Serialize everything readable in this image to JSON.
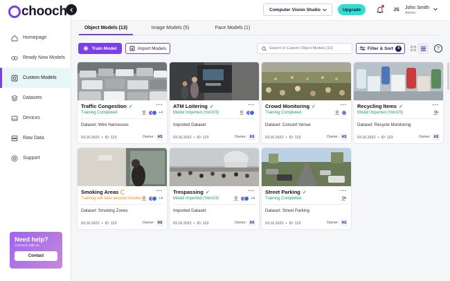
{
  "brand": {
    "name": "chooch"
  },
  "sidebar": {
    "items": [
      {
        "label": "Homepage",
        "icon": "home-icon"
      },
      {
        "label": "Ready Now Models",
        "icon": "eye-icon"
      },
      {
        "label": "Custom Models",
        "icon": "custom-models-icon",
        "active": true
      },
      {
        "label": "Datasets",
        "icon": "layers-icon"
      },
      {
        "label": "Devices",
        "icon": "device-icon"
      },
      {
        "label": "Raw Data",
        "icon": "database-icon"
      },
      {
        "label": "Support",
        "icon": "support-icon"
      }
    ],
    "help": {
      "title": "Need help?",
      "subtitle": "Connect with us",
      "button": "Contact"
    }
  },
  "topbar": {
    "studio": "Computer Vision Studio",
    "upgrade": "Upgrade",
    "user": {
      "initials": "JS",
      "name": "John Smith",
      "role": "Admin"
    }
  },
  "tabs": [
    {
      "label": "Object Models (13)",
      "active": true
    },
    {
      "label": "Image Models (5)"
    },
    {
      "label": "Face Models (1)"
    }
  ],
  "toolbar": {
    "train": "Train Model",
    "import": "Import Models",
    "search_placeholder": "Search in Custom Object Models (13)",
    "filter": "Filter & Sort",
    "filter_count": "4",
    "help": "?"
  },
  "cards": [
    {
      "title": "Traffic Congestion",
      "status": "Training Completed",
      "status_type": "done",
      "dataset": "Dataset: Wire Harnesses",
      "date": "03.16.2022",
      "id": "ID: 123",
      "owner_label": "Owner:",
      "owner": "AS",
      "people": true,
      "more": "+4"
    },
    {
      "title": "ATM Loitering",
      "status": "Model Imported (YoloV3)",
      "status_type": "import",
      "dataset": "Imported Dataset",
      "date": "03.16.2022",
      "id": "ID: 123",
      "owner_label": "Owner:",
      "owner": "AS",
      "people": true,
      "more": ""
    },
    {
      "title": "Crowd Monitoring",
      "status": "Training Completed",
      "status_type": "done",
      "dataset": "Dataset: Concert Venue",
      "date": "03.16.2022",
      "id": "ID: 123",
      "owner_label": "Owner:",
      "owner": "AS",
      "people": true,
      "more": ""
    },
    {
      "title": "Recycling Items",
      "status": "Model Imported (YoloV3)",
      "status_type": "import",
      "dataset": "Dataset: Recycle Monitoring",
      "date": "03.16.2022",
      "id": "ID: 123",
      "owner_label": "Owner:",
      "owner": "AS",
      "people": false,
      "more": ""
    },
    {
      "title": "Smoking Areas",
      "status": "Training will take several minutes",
      "status_type": "warn",
      "dataset": "Dataset: Smoking Zones",
      "date": "03.16.2022",
      "id": "ID: 123",
      "owner_label": "Owner:",
      "owner": "AS",
      "people": true,
      "more": "+4"
    },
    {
      "title": "Trespassing",
      "status": "Model Imported (YoloV3)",
      "status_type": "import",
      "dataset": "Imported Dataset",
      "date": "03.16.2022",
      "id": "ID: 123",
      "owner_label": "Owner:",
      "owner": "AS",
      "people": true,
      "more": "+4"
    },
    {
      "title": "Street Parking",
      "status": "Training Completed",
      "status_type": "done",
      "dataset": "Dataset: Street Parking",
      "date": "03.16.2022",
      "id": "ID: 123",
      "owner_label": "Owner:",
      "owner": "AS",
      "people": false,
      "more": ""
    }
  ],
  "colors": {
    "accent": "#7b3fe4",
    "teal": "#2fe0d0",
    "success": "#1a9e6a",
    "warning": "#f08a1a"
  }
}
